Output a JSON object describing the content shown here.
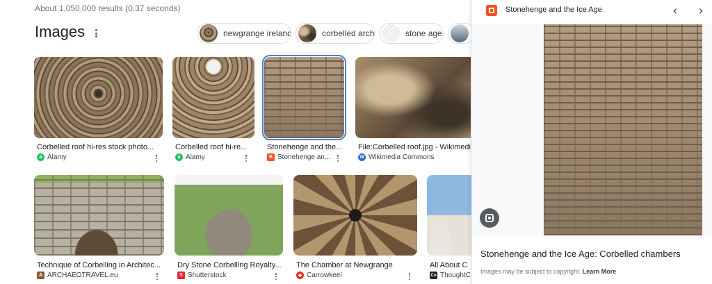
{
  "results_count": "About 1,050,000 results (0.37 seconds)",
  "images_heading": "Images",
  "chips": [
    {
      "label": "newgrange ireland"
    },
    {
      "label": "corbelled arch"
    },
    {
      "label": "stone age"
    }
  ],
  "row1": [
    {
      "title": "Corbelled roof hi-res stock photo...",
      "source": "Alamy",
      "fav_letter": "a",
      "fav_color": "#2bbf6a"
    },
    {
      "title": "Corbelled roof hi-re...",
      "source": "Alamy",
      "fav_letter": "a",
      "fav_color": "#2bbf6a"
    },
    {
      "title": "Stonehenge and the...",
      "source": "Stonehenge an...",
      "fav_letter": "B",
      "fav_color": "#f4511e",
      "selected": true
    },
    {
      "title": "File:Corbelled roof.jpg - Wikimedi",
      "source": "Wikimedia Commons",
      "fav_letter": "W",
      "fav_color": "#3366cc"
    }
  ],
  "row2": [
    {
      "title": "Technique of Corbelling in Architec...",
      "source": "ARCHAEOTRAVEL.eu",
      "fav_letter": "A",
      "fav_color": "#8b5a2b"
    },
    {
      "title": "Dry Stone Corbelling Royalty...",
      "source": "Shutterstock",
      "fav_letter": "S",
      "fav_color": "#e8262a"
    },
    {
      "title": "The Chamber at Newgrange",
      "source": "Carrowkeel",
      "fav_letter": "✚",
      "fav_color": "#d93025"
    },
    {
      "title": "All About C",
      "source": "ThoughtC",
      "fav_letter": "Co",
      "fav_color": "#202124"
    }
  ],
  "panel": {
    "site": "Stonehenge and the Ice Age",
    "prev_icon": "chevron-left-icon",
    "next_icon": "chevron-right-icon",
    "title": "Stonehenge and the Ice Age: Corbelled chambers",
    "note": "Images may be subject to copyright.",
    "learn_more": "Learn More"
  }
}
